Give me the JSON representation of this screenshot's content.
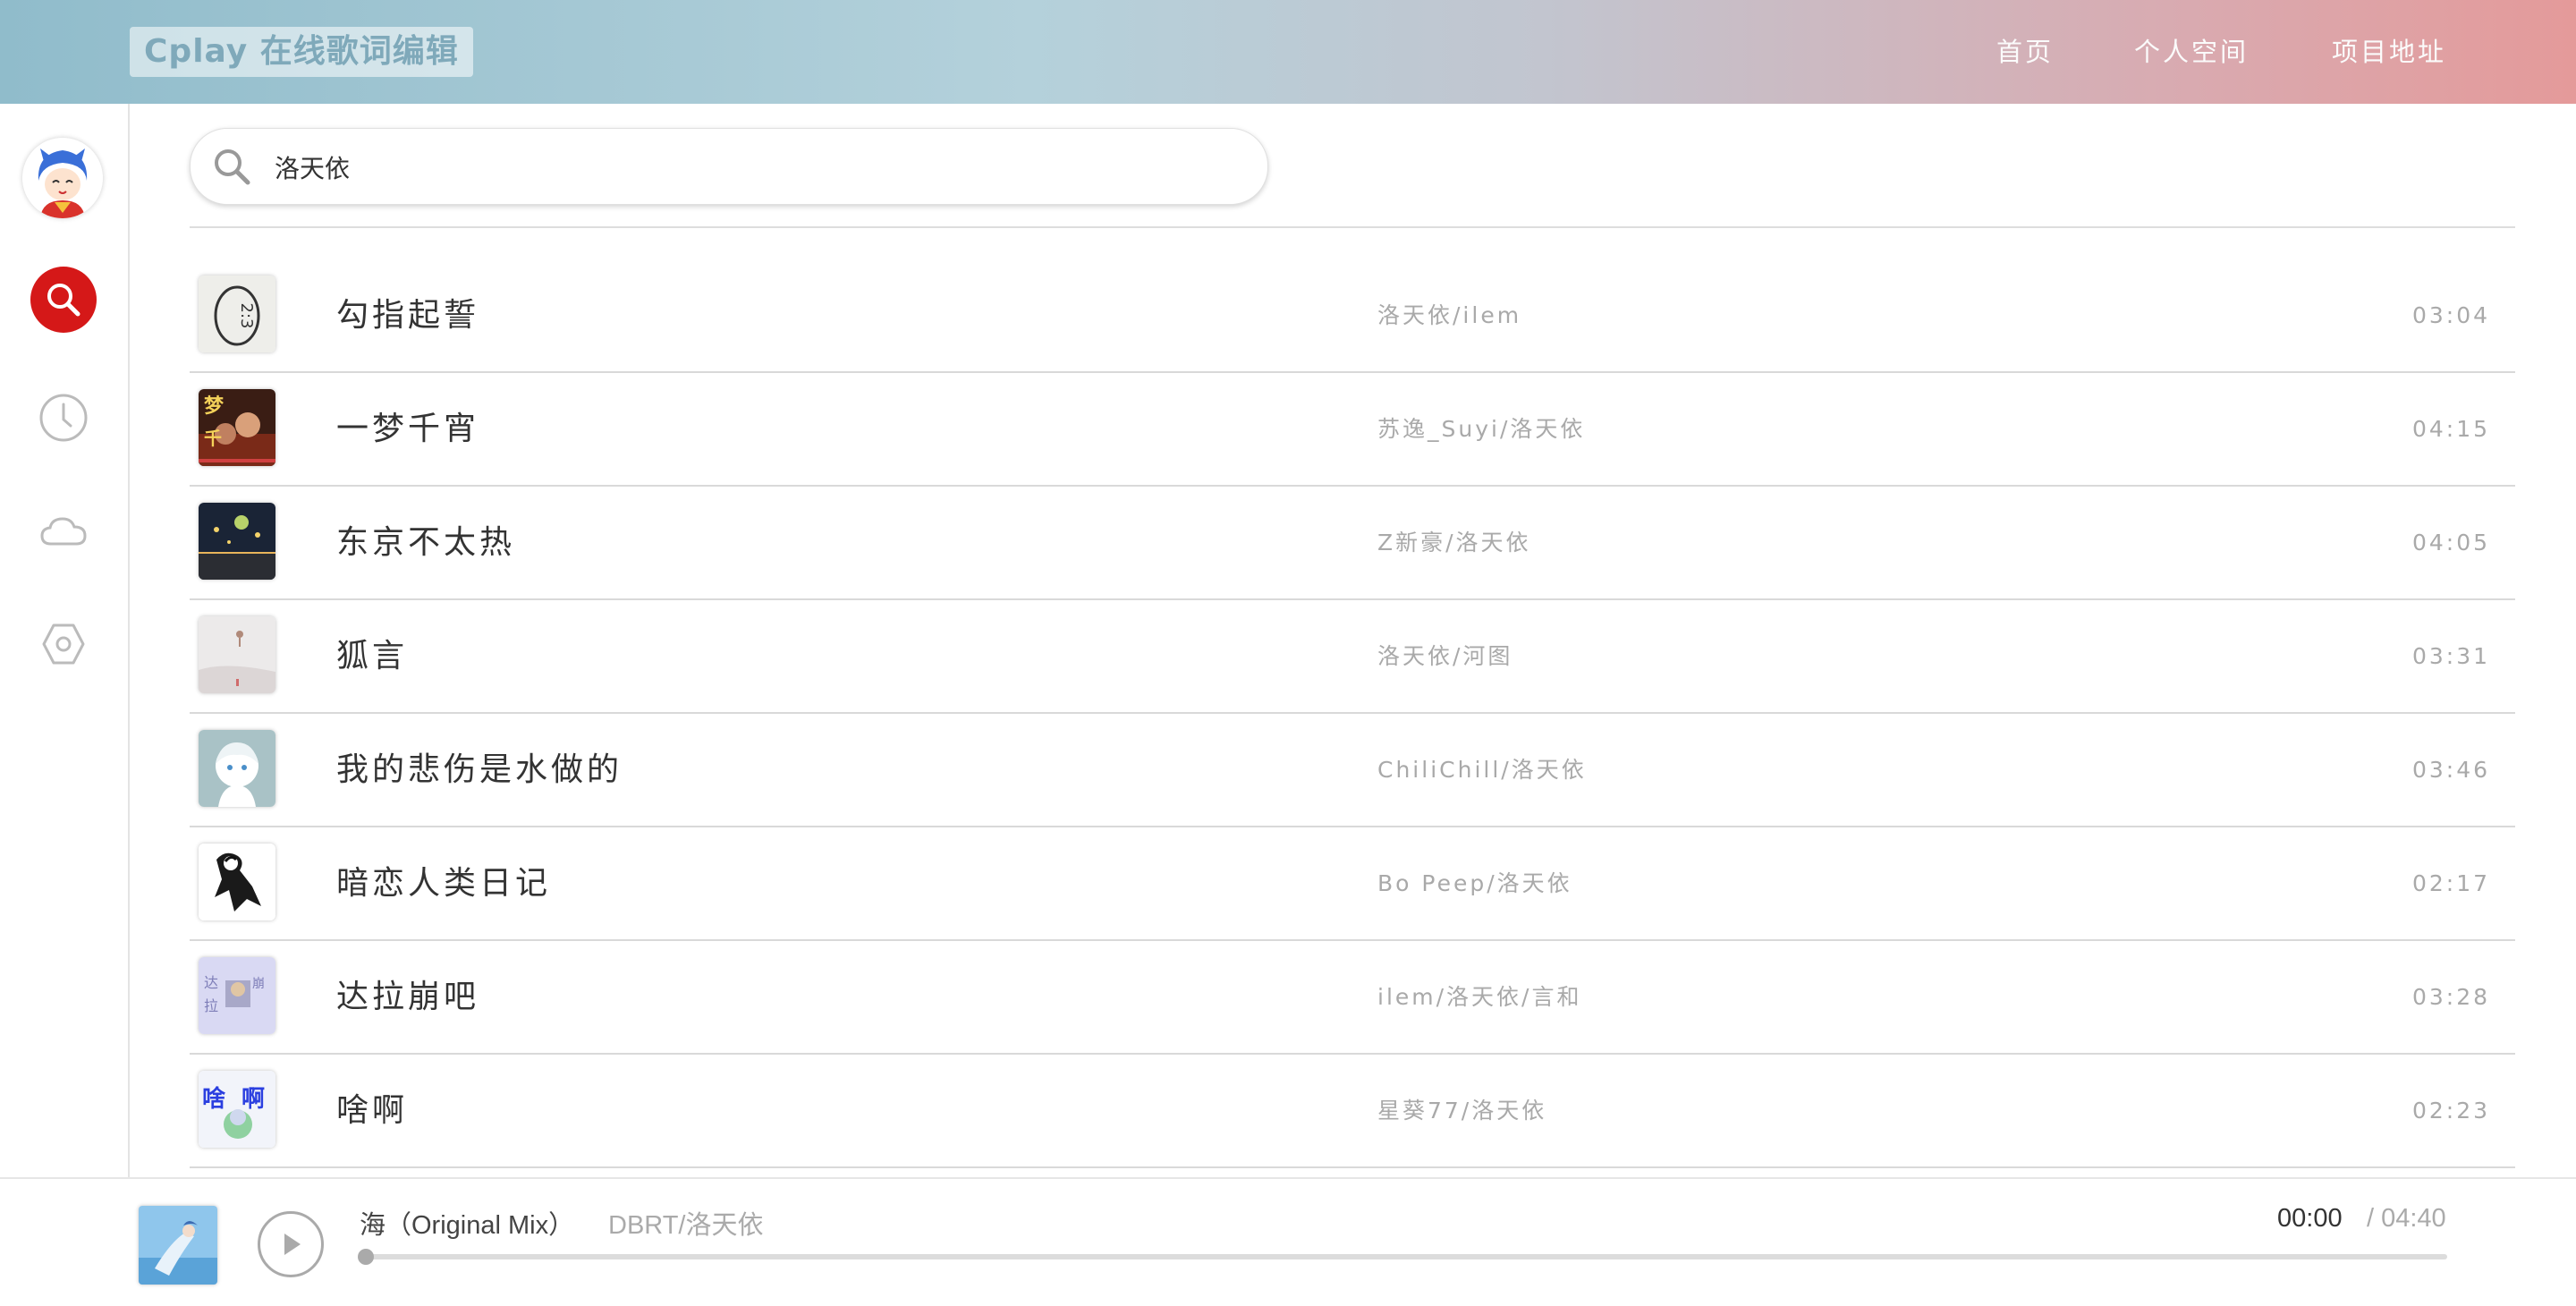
{
  "header": {
    "logo": "Cplay 在线歌词编辑",
    "nav": [
      "首页",
      "个人空间",
      "项目地址"
    ]
  },
  "sidebar": {
    "items": [
      {
        "name": "search",
        "icon": "search-icon",
        "active": true
      },
      {
        "name": "history",
        "icon": "clock-icon",
        "active": false
      },
      {
        "name": "cloud",
        "icon": "cloud-icon",
        "active": false
      },
      {
        "name": "settings",
        "icon": "hexagon-settings-icon",
        "active": false
      }
    ]
  },
  "search": {
    "value": "洛天依",
    "placeholder": ""
  },
  "songs": [
    {
      "title": "勾指起誓",
      "artist": "洛天依/ilem",
      "duration": "03:04"
    },
    {
      "title": "一梦千宵",
      "artist": "苏逸_Suyi/洛天依",
      "duration": "04:15"
    },
    {
      "title": "东京不太热",
      "artist": "Z新豪/洛天依",
      "duration": "04:05"
    },
    {
      "title": "狐言",
      "artist": "洛天依/河图",
      "duration": "03:31"
    },
    {
      "title": "我的悲伤是水做的",
      "artist": "ChiliChill/洛天依",
      "duration": "03:46"
    },
    {
      "title": "暗恋人类日记",
      "artist": "Bo Peep/洛天依",
      "duration": "02:17"
    },
    {
      "title": "达拉崩吧",
      "artist": "ilem/洛天依/言和",
      "duration": "03:28"
    },
    {
      "title": "啥啊",
      "artist": "星葵77/洛天依",
      "duration": "02:23"
    }
  ],
  "player": {
    "title": "海（Original Mix）",
    "artist": "DBRT/洛天依",
    "current_time": "00:00",
    "total_time": "/ 04:40",
    "progress": 0
  },
  "colors": {
    "accent": "#d51818",
    "header_start": "#90bccb",
    "header_end": "#e49a9a"
  }
}
